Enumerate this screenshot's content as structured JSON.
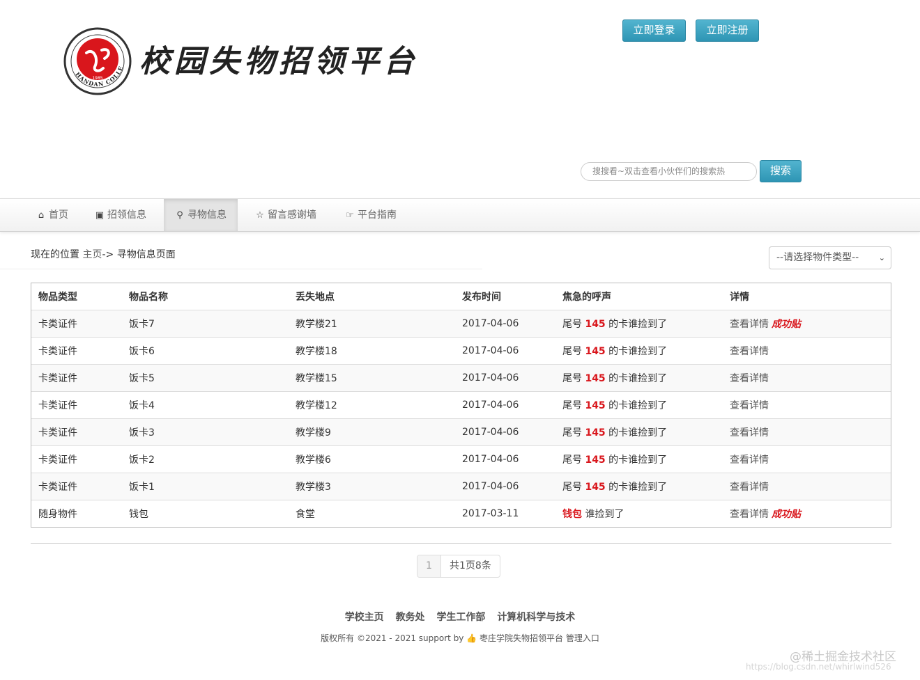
{
  "header": {
    "title": "校园失物招领平台",
    "logo_year": "1985",
    "logo_text_bottom": "HANDAN COLLEGE",
    "login_label": "立即登录",
    "register_label": "立即注册",
    "search_placeholder": "搜搜看~双击查看小伙伴们的搜索热",
    "search_label": "搜索"
  },
  "nav": {
    "items": [
      {
        "label": "首页",
        "icon": "home-icon"
      },
      {
        "label": "招领信息",
        "icon": "picture-icon"
      },
      {
        "label": "寻物信息",
        "icon": "zoom-icon"
      },
      {
        "label": "留言感谢墙",
        "icon": "star-icon"
      },
      {
        "label": "平台指南",
        "icon": "hand-right-icon"
      }
    ],
    "active_index": 2
  },
  "breadcrumb": {
    "prefix": "现在的位置",
    "home": "主页",
    "sep": "->",
    "current": "寻物信息页面"
  },
  "filter": {
    "selected": "--请选择物件类型--"
  },
  "table": {
    "headers": [
      "物品类型",
      "物品名称",
      "丢失地点",
      "发布时间",
      "焦急的呼声",
      "详情"
    ],
    "rows": [
      {
        "type": "卡类证件",
        "name": "饭卡7",
        "place": "教学楼21",
        "date": "2017-04-06",
        "call_pre": "尾号",
        "call_hl": "145",
        "call_post": "的卡谁捡到了",
        "detail": "查看详情",
        "badge": "成功贴"
      },
      {
        "type": "卡类证件",
        "name": "饭卡6",
        "place": "教学楼18",
        "date": "2017-04-06",
        "call_pre": "尾号",
        "call_hl": "145",
        "call_post": "的卡谁捡到了",
        "detail": "查看详情",
        "badge": ""
      },
      {
        "type": "卡类证件",
        "name": "饭卡5",
        "place": "教学楼15",
        "date": "2017-04-06",
        "call_pre": "尾号",
        "call_hl": "145",
        "call_post": "的卡谁捡到了",
        "detail": "查看详情",
        "badge": ""
      },
      {
        "type": "卡类证件",
        "name": "饭卡4",
        "place": "教学楼12",
        "date": "2017-04-06",
        "call_pre": "尾号",
        "call_hl": "145",
        "call_post": "的卡谁捡到了",
        "detail": "查看详情",
        "badge": ""
      },
      {
        "type": "卡类证件",
        "name": "饭卡3",
        "place": "教学楼9",
        "date": "2017-04-06",
        "call_pre": "尾号",
        "call_hl": "145",
        "call_post": "的卡谁捡到了",
        "detail": "查看详情",
        "badge": ""
      },
      {
        "type": "卡类证件",
        "name": "饭卡2",
        "place": "教学楼6",
        "date": "2017-04-06",
        "call_pre": "尾号",
        "call_hl": "145",
        "call_post": "的卡谁捡到了",
        "detail": "查看详情",
        "badge": ""
      },
      {
        "type": "卡类证件",
        "name": "饭卡1",
        "place": "教学楼3",
        "date": "2017-04-06",
        "call_pre": "尾号",
        "call_hl": "145",
        "call_post": "的卡谁捡到了",
        "detail": "查看详情",
        "badge": ""
      },
      {
        "type": "随身物件",
        "name": "钱包",
        "place": "食堂",
        "date": "2017-03-11",
        "call_pre": "",
        "call_hl": "钱包",
        "call_post": "谁捡到了",
        "detail": "查看详情",
        "badge": "成功贴"
      }
    ]
  },
  "pagination": {
    "current_page": "1",
    "info": "共1页8条"
  },
  "footer": {
    "links": [
      "学校主页",
      "教务处",
      "学生工作部",
      "计算机科学与技术"
    ],
    "copyright_pre": "版权所有 ©2021 - 2021 support by",
    "copyright_post": "枣庄学院失物招领平台 管理入口"
  },
  "watermark": {
    "line1": "@稀土掘金技术社区",
    "line2": "https://blog.csdn.net/whirlwind526"
  },
  "colors": {
    "accent": "#3aa3c2",
    "highlight": "#d9161c"
  }
}
